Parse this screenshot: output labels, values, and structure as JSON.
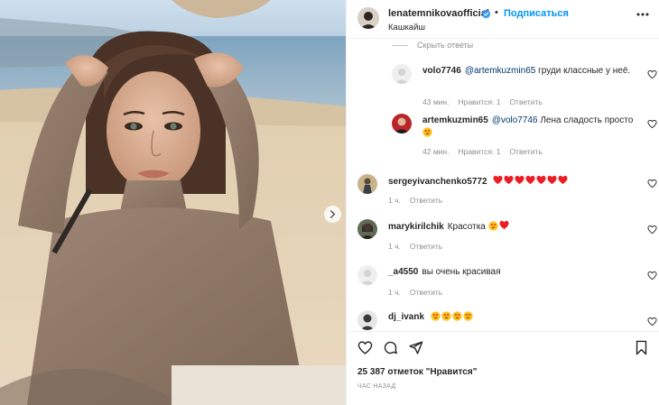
{
  "header": {
    "username": "lenatemnikovaofficial",
    "separator": "•",
    "follow_label": "Подписаться",
    "location": "Кашкайш"
  },
  "comments": {
    "hide_replies": "Скрыть ответы",
    "items": [
      {
        "username": "volo7746",
        "mention": "@artemkuzmin65",
        "text": " груди классные у неё.",
        "time": "43 мин.",
        "likes": "Нравится: 1",
        "reply": "Ответить",
        "avatar": "placeholder-avatar"
      },
      {
        "username": "artemkuzmin65",
        "mention": "@volo7746",
        "text": " Лена сладость просто",
        "emoji": [
          "heart-eyes"
        ],
        "time": "42 мин.",
        "likes": "Нравится: 1",
        "reply": "Ответить",
        "avatar": "photo-avatar"
      },
      {
        "username": "sergeyivanchenko5772",
        "text": "",
        "emoji": [
          "red-heart",
          "red-heart",
          "red-heart",
          "red-heart",
          "red-heart",
          "red-heart",
          "red-heart"
        ],
        "time": "1 ч.",
        "reply": "Ответить",
        "avatar": "photo-avatar"
      },
      {
        "username": "marykirilchik",
        "text": "Красотка",
        "emoji": [
          "heart-eyes",
          "red-heart"
        ],
        "time": "1 ч.",
        "reply": "Ответить",
        "avatar": "photo-avatar"
      },
      {
        "username": "_a4550",
        "text": "вы очень красивая",
        "time": "1 ч.",
        "reply": "Ответить",
        "avatar": "placeholder-avatar"
      },
      {
        "username": "dj_ivank",
        "text": "",
        "emoji": [
          "heart-eyes",
          "heart-eyes",
          "heart-eyes",
          "heart-eyes"
        ],
        "avatar": "photo-avatar"
      }
    ]
  },
  "actions": {
    "likes": "25 387 отметок \"Нравится\"",
    "date": "ЧАС НАЗАД",
    "icons": [
      "heart-icon",
      "comment-icon",
      "share-icon",
      "bookmark-icon"
    ]
  },
  "colors": {
    "accent": "#0095f6",
    "verified": "#3897f0",
    "heart": "#ed1c24",
    "muted": "#8e8e8e",
    "mention": "#00376b"
  }
}
